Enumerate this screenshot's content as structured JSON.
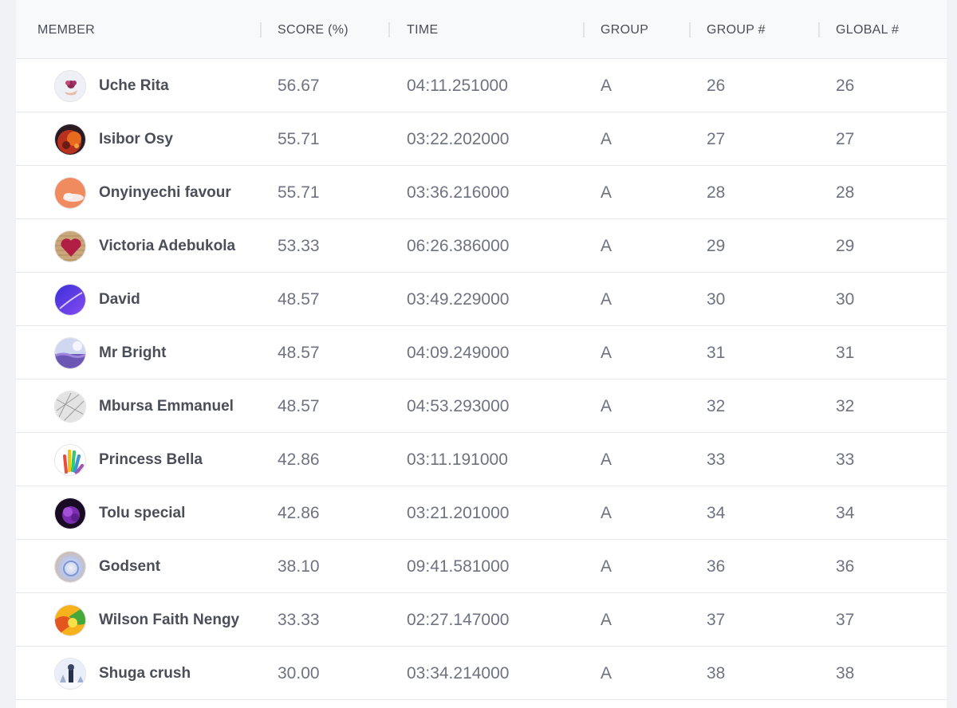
{
  "table": {
    "columns": [
      "MEMBER",
      "SCORE (%)",
      "TIME",
      "GROUP",
      "GROUP #",
      "GLOBAL #"
    ],
    "rows": [
      {
        "avatar": "flower-bouquet-avatar",
        "name": "Uche Rita",
        "score": "56.67",
        "time": "04:11.251000",
        "group": "A",
        "group_rank": "26",
        "global_rank": "26"
      },
      {
        "avatar": "red-abstract-avatar",
        "name": "Isibor Osy",
        "score": "55.71",
        "time": "03:22.202000",
        "group": "A",
        "group_rank": "27",
        "global_rank": "27"
      },
      {
        "avatar": "sunset-cloud-avatar",
        "name": "Onyinyechi favour",
        "score": "55.71",
        "time": "03:36.216000",
        "group": "A",
        "group_rank": "28",
        "global_rank": "28"
      },
      {
        "avatar": "heart-avatar",
        "name": "Victoria Adebukola",
        "score": "53.33",
        "time": "06:26.386000",
        "group": "A",
        "group_rank": "29",
        "global_rank": "29"
      },
      {
        "avatar": "purple-gradient-avatar",
        "name": "David",
        "score": "48.57",
        "time": "03:49.229000",
        "group": "A",
        "group_rank": "30",
        "global_rank": "30"
      },
      {
        "avatar": "lavender-field-avatar",
        "name": "Mr Bright",
        "score": "48.57",
        "time": "04:09.249000",
        "group": "A",
        "group_rank": "31",
        "global_rank": "31"
      },
      {
        "avatar": "sketch-pattern-avatar",
        "name": "Mbursa Emmanuel",
        "score": "48.57",
        "time": "04:53.293000",
        "group": "A",
        "group_rank": "32",
        "global_rank": "32"
      },
      {
        "avatar": "rainbow-hand-avatar",
        "name": "Princess Bella",
        "score": "42.86",
        "time": "03:11.191000",
        "group": "A",
        "group_rank": "33",
        "global_rank": "33"
      },
      {
        "avatar": "purple-flower-avatar",
        "name": "Tolu special",
        "score": "42.86",
        "time": "03:21.201000",
        "group": "A",
        "group_rank": "34",
        "global_rank": "34"
      },
      {
        "avatar": "holographic-avatar",
        "name": "Godsent",
        "score": "38.10",
        "time": "09:41.581000",
        "group": "A",
        "group_rank": "36",
        "global_rank": "36"
      },
      {
        "avatar": "colorful-swirl-avatar",
        "name": "Wilson Faith Nengy",
        "score": "33.33",
        "time": "02:27.147000",
        "group": "A",
        "group_rank": "37",
        "global_rank": "37"
      },
      {
        "avatar": "winter-scene-avatar",
        "name": "Shuga crush",
        "score": "30.00",
        "time": "03:34.214000",
        "group": "A",
        "group_rank": "38",
        "global_rank": "38"
      }
    ]
  },
  "colors": {
    "page_background": "#f1f2f6",
    "header_background": "#f8f9fb",
    "header_text": "#4a4d57",
    "name_text": "#4b4e59",
    "cell_text": "#6f7280",
    "row_divider": "#e6e7eb"
  }
}
